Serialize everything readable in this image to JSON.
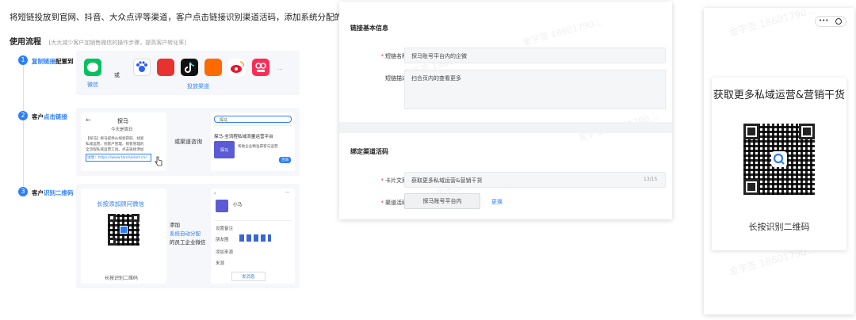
{
  "left": {
    "title": "将短链投放到官网、抖音、大众点评等渠道，客户点击链接识别渠道活码，添加系统分配的员工企业微信",
    "flow_label": "使用流程",
    "flow_note": "[大大减少客户加销售微信的操作步骤，提高客户转化率]",
    "steps": [
      {
        "num": "1",
        "pre": "复制链接",
        "post": "配置到"
      },
      {
        "num": "2",
        "pre": "客户",
        "hl": "点击链接"
      },
      {
        "num": "3",
        "pre": "客户",
        "hl": "识别二维码"
      }
    ],
    "step1": {
      "or": "或",
      "wechat": "微信",
      "channels": "投放渠道",
      "more": "..."
    },
    "step2": {
      "mock_back": "←",
      "mock_title": "探马",
      "mock_sub": "今天是周日",
      "mock_body1": "【探马】探马提供从线索获取、线索",
      "mock_body2": "私域运营、到客户管理、销售管理的",
      "mock_body3": "全流程私域运营工具。点击链接添加",
      "mock_link": "详情：https://www.tanmarket.cn/...",
      "or_text": "或渠道咨询",
      "search_text": "探马",
      "result_title": "探马-全流程私域流量运营平台",
      "result_desc": "帮助企业精准获客与运营",
      "result_logo": "探马",
      "result_btn": "咨询"
    },
    "step3": {
      "poster_title": "长按添加顾问微信",
      "poster_cap": "长按识别二维码",
      "add_text1": "添加",
      "add_text2": "系统自动分配",
      "add_text3": "的员工企业微信",
      "profile_name": "小马",
      "row1": "设置备注",
      "row2": "朋友圈",
      "row3": "添加来源",
      "row4": "来源",
      "send_btn": "发消息"
    }
  },
  "form": {
    "sec1": "链接基本信息",
    "name_label": "短链名称",
    "name_value": "探马账号平台内的企微",
    "desc_label": "短链描述",
    "desc_value": "扫合页内的查看更多",
    "sec2": "绑定渠道活码",
    "card_label": "卡片文案",
    "card_value": "获取更多私域运营&营销干货",
    "card_count": "13/15",
    "code_label": "渠道活码",
    "code_value": "探马账号平台内",
    "change_link": "更换"
  },
  "phone": {
    "menu_dots": "•••",
    "title": "获取更多私域运营&营销干货",
    "caption": "长按识别二维码",
    "watermark": "金字签 18601790..."
  },
  "colors": {
    "accent": "#2d7ff9",
    "required": "#e33333"
  }
}
